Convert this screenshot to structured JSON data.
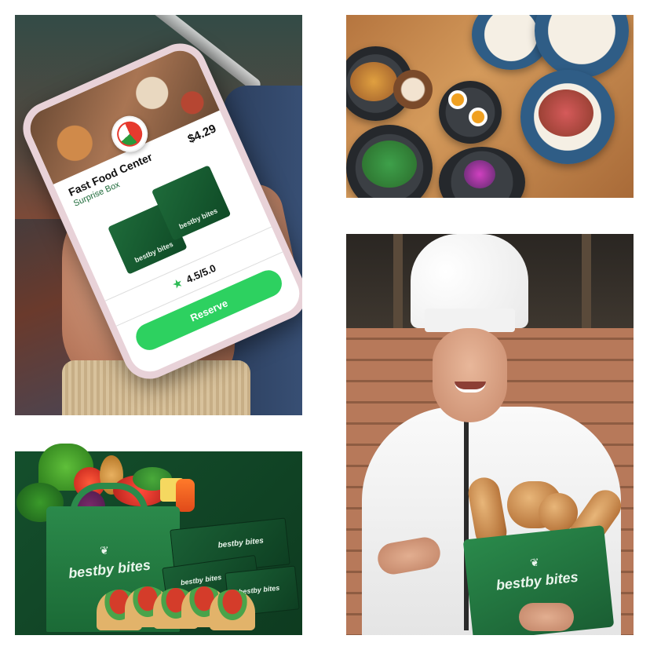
{
  "phone_app": {
    "store_name": "Fast Food Center",
    "box_type": "Surprise Box",
    "price": "$4.29",
    "rating": "4.5/5.0",
    "reserve_label": "Reserve",
    "box_brand": "bestby bites",
    "accent_color": "#2dd160",
    "brand_green": "#1e6b3a"
  },
  "grocery_tile": {
    "bag_logo": "bestby bites",
    "box_logo_1": "bestby bites",
    "box_logo_2": "bestby bites",
    "box_logo_3": "bestby bites"
  },
  "chef_tile": {
    "bag_logo": "bestby bites"
  },
  "icons": {
    "star": "star-icon",
    "leaf": "leaf-icon"
  }
}
